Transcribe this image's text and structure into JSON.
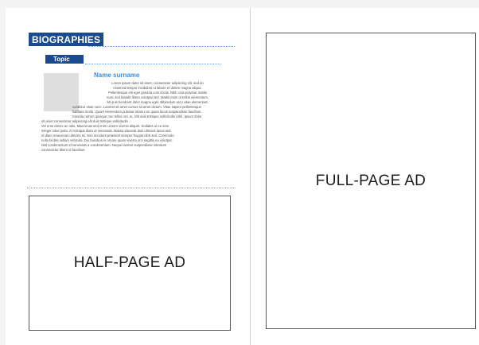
{
  "left_page": {
    "section_title": "BIOGRAPHIES",
    "topic_label": "Topic",
    "bio": {
      "name": "Name surname",
      "lines": [
        "Lorem ipsum dolor sit amet, consectetur adipiscing elit, sed do",
        "eiusmod tempor incididunt ut labore et dolore magna aliqua.",
        "Pellentesque elit eget gravida cum sociis. Nibh cras pulvinar mattis",
        "nunc sed blandit libero volutpat sed. Mattis enim ut tellus elementum.",
        "Mi quis hendrerit dolor magna eget. Bibendum arcu vitae elementum",
        "curabitur vitae nunc. Laoreet sit amet cursus sit amet dictum. Vitae sapien pellentesque",
        "habitant morbi. Quam elementum pulvinar etiam non quam lacus suspendisse faucibus.",
        "Gravida rutrum quisque non tellus orci ac. Elit duis tristique sollicitudin nibh. Ipsum dolor",
        "sit amet consectetur adipiscing elit duis tristique sollicitudin.",
        "Vel eros donec ac odio. Maecenas sed enim ut sem viverra aliquet. Sodales ut eu sem",
        "integer vitae justo. At volutpat diam ut venenatis. Massa placerat duis ultricies lacus sed.",
        "Id diam maecenas ultricies mi. Nec tincidunt praesent semper feugiat nibh sed. Commodo",
        "nulla facilisi nullam vehicula. Dui faucibus in ornare quam viverra orci sagittis eu volutpat.",
        "Nisl condimentum id venenatis a condimentum. Neque laoreet suspendisse interdum",
        "consectetur libero id faucibus."
      ]
    },
    "half_page_ad_label": "HALF-PAGE AD"
  },
  "right_page": {
    "full_page_ad_label": "FULL-PAGE AD"
  },
  "colors": {
    "header_blue": "#1b4b8f",
    "name_blue": "#3b8fd8",
    "divider_dots": "#7aa4d6"
  }
}
